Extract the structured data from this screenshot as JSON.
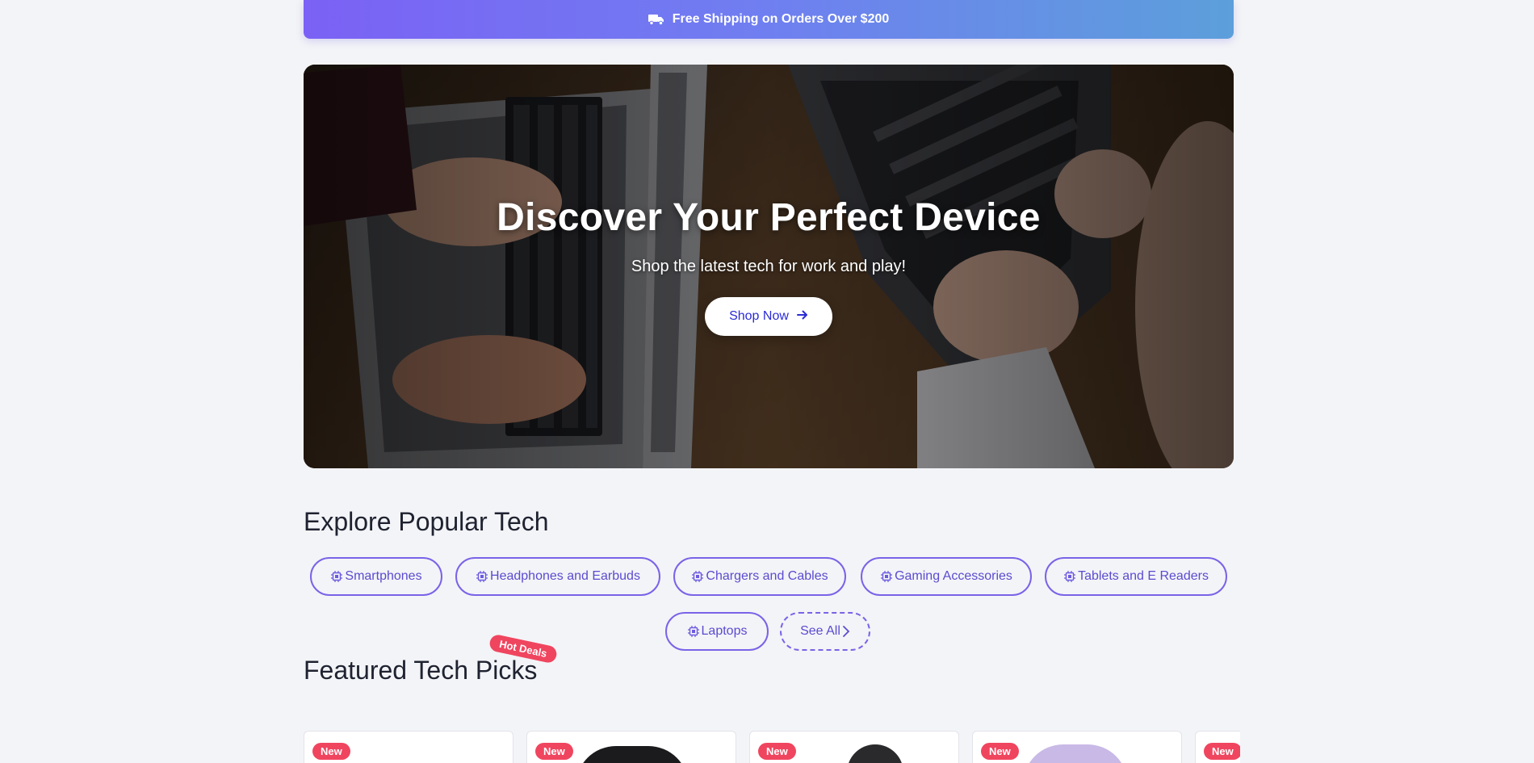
{
  "shipping_banner": {
    "text": "Free Shipping on Orders Over $200",
    "icon": "truck-icon"
  },
  "hero": {
    "title": "Discover Your Perfect Device",
    "subtitle": "Shop the latest tech for work and play!",
    "cta_label": "Shop Now",
    "cta_icon": "arrow-right-icon"
  },
  "explore": {
    "title": "Explore Popular Tech",
    "categories": [
      {
        "label": "Smartphones",
        "icon": "chip-icon"
      },
      {
        "label": "Headphones and Earbuds",
        "icon": "chip-icon"
      },
      {
        "label": "Chargers and Cables",
        "icon": "chip-icon"
      },
      {
        "label": "Gaming Accessories",
        "icon": "chip-icon"
      },
      {
        "label": "Tablets and E Readers",
        "icon": "chip-icon"
      },
      {
        "label": "Laptops",
        "icon": "chip-icon"
      }
    ],
    "see_all_label": "See All",
    "see_all_icon": "chevron-right-icon"
  },
  "featured": {
    "title": "Featured Tech Picks",
    "badge": "Hot Deals",
    "products": [
      {
        "badge": "New"
      },
      {
        "badge": "New"
      },
      {
        "badge": "New"
      },
      {
        "badge": "New"
      },
      {
        "badge": "New"
      }
    ]
  },
  "colors": {
    "accent": "#7a63e8",
    "badge_red": "#f0455f",
    "banner_start": "#7b61f5",
    "banner_end": "#5c9fdb"
  }
}
